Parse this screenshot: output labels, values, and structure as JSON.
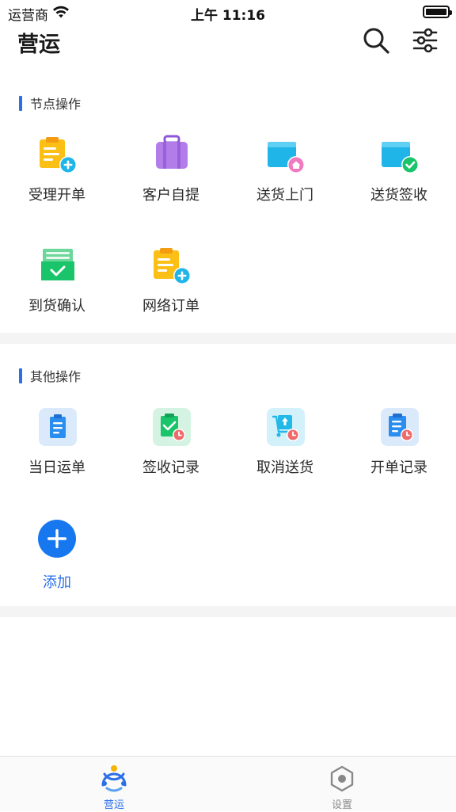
{
  "status": {
    "carrier": "运营商",
    "time": "上午 11:16"
  },
  "nav": {
    "title": "营运"
  },
  "node_section": {
    "title": "节点操作",
    "items": [
      {
        "label": "受理开单",
        "icon": "doc-add-icon"
      },
      {
        "label": "客户自提",
        "icon": "suitcase-icon"
      },
      {
        "label": "送货上门",
        "icon": "home-delivery-icon"
      },
      {
        "label": "送货签收",
        "icon": "delivery-check-icon"
      },
      {
        "label": "到货确认",
        "icon": "arrival-check-icon"
      },
      {
        "label": "网络订单",
        "icon": "network-order-icon"
      }
    ]
  },
  "other_section": {
    "title": "其他操作",
    "items": [
      {
        "label": "当日运单",
        "icon": "daily-waybill-icon"
      },
      {
        "label": "签收记录",
        "icon": "sign-record-icon"
      },
      {
        "label": "取消送货",
        "icon": "cancel-delivery-icon"
      },
      {
        "label": "开单记录",
        "icon": "order-record-icon"
      },
      {
        "label": "添加",
        "icon": "add-circle-icon"
      }
    ]
  },
  "tabs": [
    {
      "label": "营运",
      "active": true
    },
    {
      "label": "设置",
      "active": false
    }
  ],
  "colors": {
    "accent": "#2a6fe8",
    "gap": "#f4f4f5"
  }
}
